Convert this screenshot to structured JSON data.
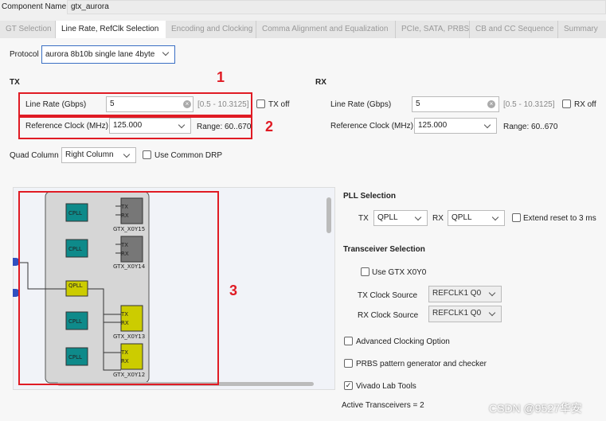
{
  "component": {
    "label": "Component Name",
    "value": "gtx_aurora"
  },
  "tabs": [
    {
      "label": "GT Selection"
    },
    {
      "label": "Line Rate, RefClk Selection",
      "active": true
    },
    {
      "label": "Encoding and Clocking"
    },
    {
      "label": "Comma Alignment and Equalization"
    },
    {
      "label": "PCIe, SATA, PRBS"
    },
    {
      "label": "CB and CC Sequence"
    },
    {
      "label": "Summary"
    }
  ],
  "protocol": {
    "label": "Protocol",
    "value": "aurora 8b10b single lane 4byte"
  },
  "tx": {
    "title": "TX",
    "line_rate_label": "Line Rate (Gbps)",
    "line_rate": "5",
    "line_rate_range": "[0.5 - 10.3125]",
    "off_label": "TX off",
    "off_checked": false,
    "refclk_label": "Reference Clock (MHz)",
    "refclk": "125.000",
    "refclk_range": "Range: 60..670"
  },
  "rx": {
    "title": "RX",
    "line_rate_label": "Line Rate (Gbps)",
    "line_rate": "5",
    "line_rate_range": "[0.5 - 10.3125]",
    "off_label": "RX off",
    "off_checked": false,
    "refclk_label": "Reference Clock (MHz)",
    "refclk": "125.000",
    "refclk_range": "Range: 60..670"
  },
  "quad": {
    "label": "Quad Column",
    "value": "Right Column",
    "common_drp_label": "Use Common DRP",
    "common_drp": false
  },
  "annotations": [
    "1",
    "2",
    "3"
  ],
  "diagram": {
    "cpll": "CPLL",
    "qpll": "QPLL",
    "tx": "TX",
    "rx": "RX",
    "gtx": [
      "GTX_X0Y15",
      "GTX_X0Y14",
      "GTX_X0Y13",
      "GTX_X0Y12"
    ],
    "colors": {
      "cpll": "#0e8a8a",
      "qpll": "#cccc00",
      "gtx_unused": "#777777",
      "gtx_used": "#cccc00"
    }
  },
  "pll": {
    "title": "PLL Selection",
    "tx_label": "TX",
    "tx_value": "QPLL",
    "rx_label": "RX",
    "rx_value": "QPLL",
    "extend_label": "Extend reset to 3 ms",
    "extend": false
  },
  "transceiver": {
    "title": "Transceiver Selection",
    "use_label": "Use GTX X0Y0",
    "use": false,
    "tx_clk_label": "TX Clock Source",
    "tx_clk": "REFCLK1 Q0",
    "rx_clk_label": "RX Clock Source",
    "rx_clk": "REFCLK1 Q0"
  },
  "options": [
    {
      "label": "Advanced Clocking Option",
      "checked": false
    },
    {
      "label": "PRBS pattern generator and checker",
      "checked": false
    },
    {
      "label": "Vivado Lab Tools",
      "checked": true
    }
  ],
  "active": "Active Transceivers = 2",
  "watermark": "CSDN @9527华安"
}
